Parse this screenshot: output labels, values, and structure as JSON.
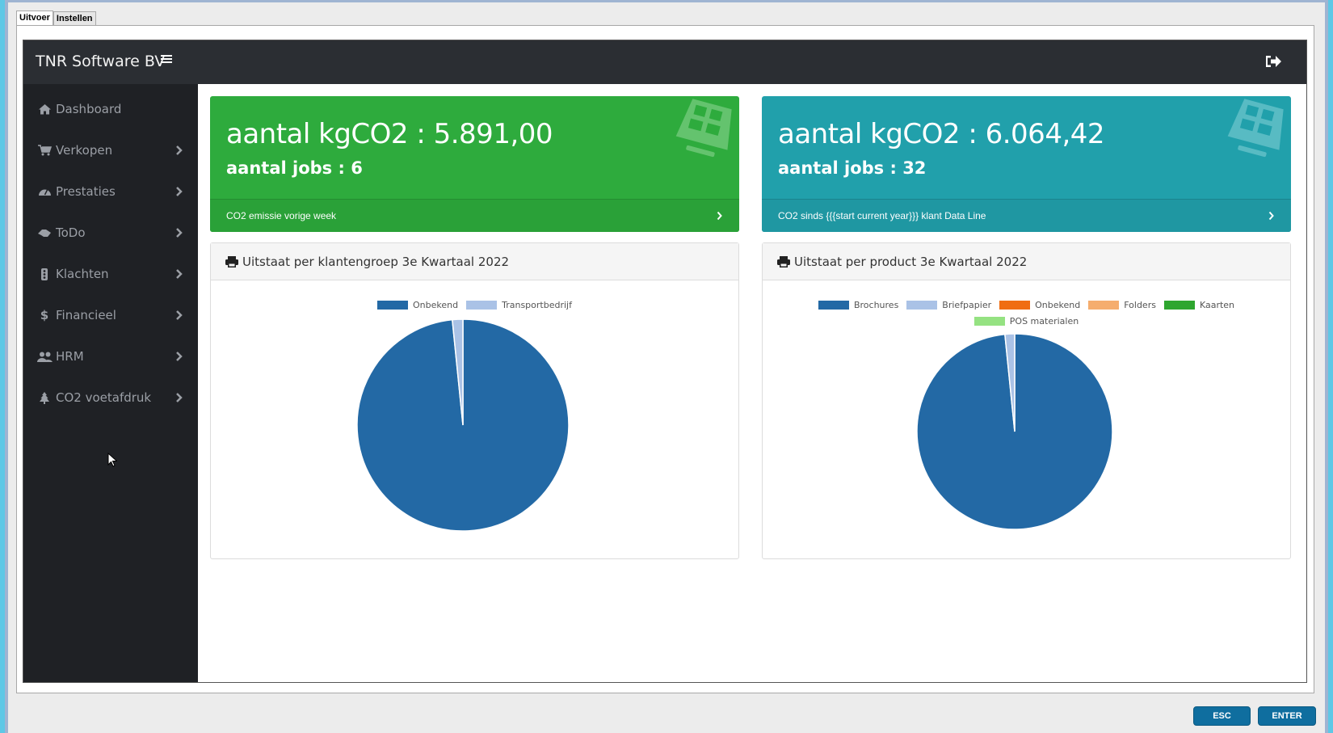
{
  "window": {
    "tabs": [
      {
        "label": "Uitvoer",
        "active": true
      },
      {
        "label": "Instellen",
        "active": false
      }
    ],
    "buttons": {
      "esc": "ESC",
      "enter": "ENTER"
    }
  },
  "header": {
    "brand": "TNR Software BV",
    "menu_icon": "bars-icon",
    "logout_icon": "sign-out-icon"
  },
  "sidebar": {
    "items": [
      {
        "label": "Dashboard",
        "icon": "home-icon",
        "has_children": false
      },
      {
        "label": "Verkopen",
        "icon": "shopping-cart-icon",
        "has_children": true
      },
      {
        "label": "Prestaties",
        "icon": "dashboard-gauge-icon",
        "has_children": true
      },
      {
        "label": "ToDo",
        "icon": "handshake-icon",
        "has_children": true
      },
      {
        "label": "Klachten",
        "icon": "traffic-light-icon",
        "has_children": true
      },
      {
        "label": "Financieel",
        "icon": "dollar-icon",
        "has_children": true
      },
      {
        "label": "HRM",
        "icon": "users-icon",
        "has_children": true
      },
      {
        "label": "CO2 voetafdruk",
        "icon": "tree-icon",
        "has_children": true
      }
    ]
  },
  "cards": [
    {
      "title": "aantal kgCO2 : 5.891,00",
      "subtitle": "aantal jobs : 6",
      "footer": "CO2 emissie vorige week",
      "color": "#2eab3d",
      "icon": "solar-panel-icon"
    },
    {
      "title": "aantal kgCO2 : 6.064,42",
      "subtitle": "aantal jobs : 32",
      "footer": "CO2 sinds {{{start current year}}} klant Data Line",
      "color": "#21a0ab",
      "icon": "solar-panel-icon"
    }
  ],
  "panels": [
    {
      "title": "Uitstaat per klantengroep 3e Kwartaal 2022",
      "icon": "print-icon"
    },
    {
      "title": "Uitstaat per product 3e Kwartaal 2022",
      "icon": "print-icon"
    }
  ],
  "chart_data": [
    {
      "type": "pie",
      "title": "Uitstaat per klantengroep 3e Kwartaal 2022",
      "legend": "top",
      "categories": [
        "Onbekend",
        "Transportbedrijf"
      ],
      "values": [
        98.4,
        1.6
      ],
      "colors": [
        "#2369a5",
        "#aac2e6"
      ]
    },
    {
      "type": "pie",
      "title": "Uitstaat per product 3e Kwartaal 2022",
      "legend": "top",
      "categories": [
        "Brochures",
        "Briefpapier",
        "Onbekend",
        "Folders",
        "Kaarten",
        "POS materialen"
      ],
      "values": [
        98.4,
        1.6,
        0,
        0,
        0,
        0
      ],
      "colors": [
        "#2369a5",
        "#aac2e6",
        "#f06d12",
        "#f5ad6e",
        "#2ea62f",
        "#95e282"
      ]
    }
  ]
}
